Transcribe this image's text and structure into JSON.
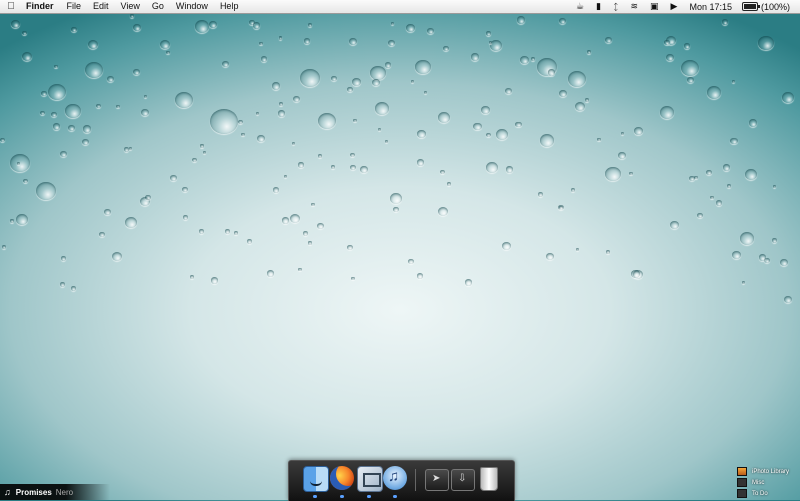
{
  "menubar": {
    "app_name": "Finder",
    "menus": [
      "File",
      "Edit",
      "View",
      "Go",
      "Window",
      "Help"
    ],
    "clock": "Mon 17:15",
    "battery_percent": "(100%)",
    "battery_level": 1.0,
    "status_icons": [
      "coffee-cup-icon",
      "signal-bars-icon",
      "bluetooth-icon",
      "wifi-icon",
      "display-icon",
      "volume-icon"
    ]
  },
  "dock": {
    "apps": [
      "finder-icon",
      "firefox-icon",
      "mail-icon",
      "itunes-icon"
    ],
    "stacks": [
      "applications-folder-icon",
      "downloads-folder-icon"
    ],
    "trash": "trash-icon"
  },
  "now_playing": {
    "song": "Promises",
    "artist": "Nero"
  },
  "stacks_list": {
    "items": [
      "iPhoto Library",
      "Misc",
      "To Do"
    ]
  }
}
